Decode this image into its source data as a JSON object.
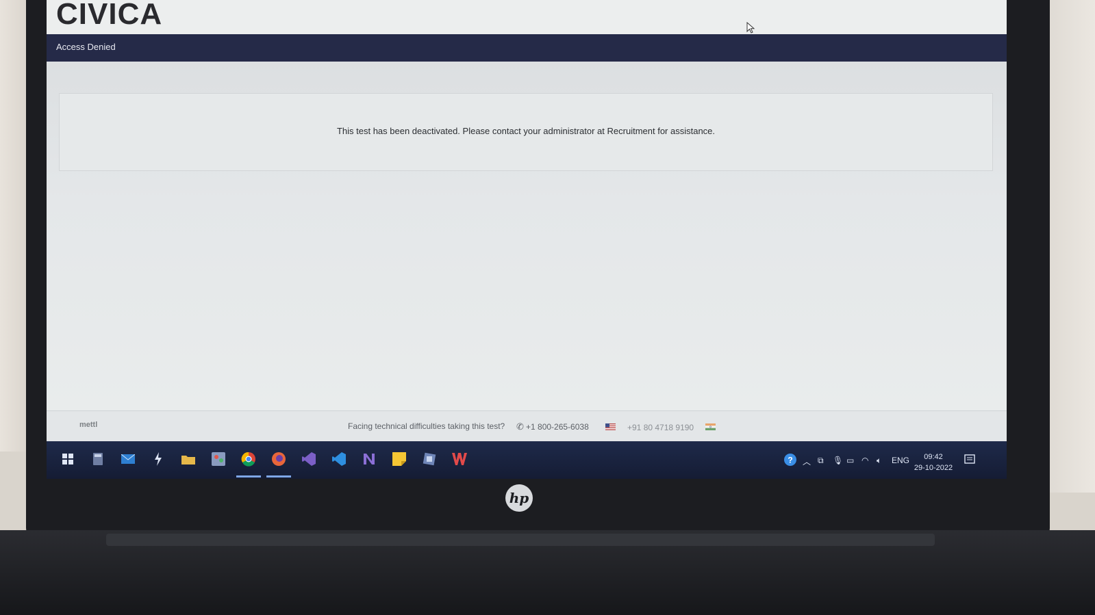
{
  "app": {
    "logo": "CIVICA",
    "page_title": "Access Denied"
  },
  "message": "This test has been deactivated. Please contact your administrator at Recruitment for assistance.",
  "footer": {
    "brand": "mettl",
    "help_text": "Facing technical difficulties taking this test?",
    "phone_us": "+1 800-265-6038",
    "phone_in": "+91 80 4718 9190"
  },
  "taskbar": {
    "apps": [
      "windows-start",
      "calculator",
      "mail",
      "bolt-app",
      "file-explorer",
      "paint",
      "chrome",
      "firefox",
      "visual-studio",
      "vscode",
      "onenote",
      "sticky-notes",
      "virtualbox",
      "wps-office"
    ],
    "language": "ENG",
    "time": "09:42",
    "date": "29-10-2022"
  },
  "hardware": {
    "brand": "hp"
  }
}
